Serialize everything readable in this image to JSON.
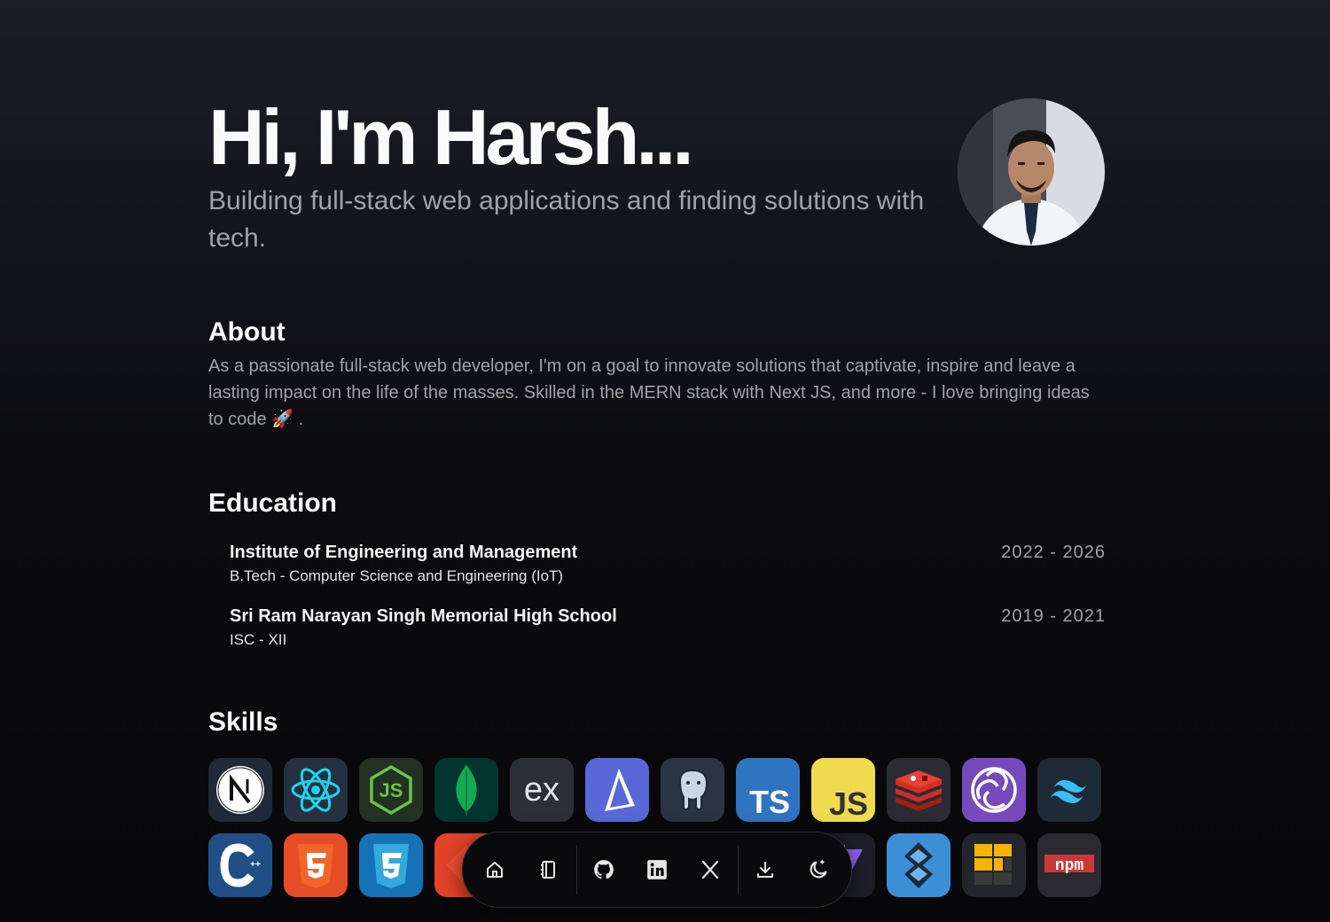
{
  "hero": {
    "title": "Hi, I'm Harsh...",
    "subtitle": "Building full-stack web applications and finding solutions with tech."
  },
  "about": {
    "heading": "About",
    "text": "As a passionate full-stack web developer, I'm on a goal to innovate solutions that captivate, inspire and leave a lasting impact on the life of the masses. Skilled in the MERN stack with Next JS, and more - I love bringing ideas to code 🚀 ."
  },
  "education": {
    "heading": "Education",
    "items": [
      {
        "school": "Institute of Engineering and Management",
        "degree": "B.Tech - Computer Science and Engineering (IoT)",
        "dates": "2022 - 2026"
      },
      {
        "school": "Sri Ram Narayan Singh Memorial High School",
        "degree": "ISC - XII",
        "dates": "2019 - 2021"
      }
    ]
  },
  "skills": {
    "heading": "Skills",
    "icons": [
      "nextjs-icon",
      "react-icon",
      "nodejs-icon",
      "mongodb-icon",
      "express-icon",
      "prisma-icon",
      "postgresql-icon",
      "typescript-icon",
      "javascript-icon",
      "redis-icon",
      "redux-icon",
      "tailwind-icon",
      "cplusplus-icon",
      "html5-icon",
      "css3-icon",
      "git-icon",
      "vite-icon",
      "solidity-icon",
      "appwrite-icon",
      "npm-icon"
    ],
    "labels": {
      "typescript": "TS",
      "javascript": "JS",
      "express": "ex",
      "npm": "npm"
    }
  },
  "dock": {
    "items": [
      "home-icon",
      "notebook-icon",
      "github-icon",
      "linkedin-icon",
      "x-icon",
      "download-icon",
      "theme-toggle-icon"
    ]
  },
  "colors": {
    "background": "#0b0b0e",
    "muted_text": "#a1a1aa",
    "heading_text": "#fafafa"
  }
}
